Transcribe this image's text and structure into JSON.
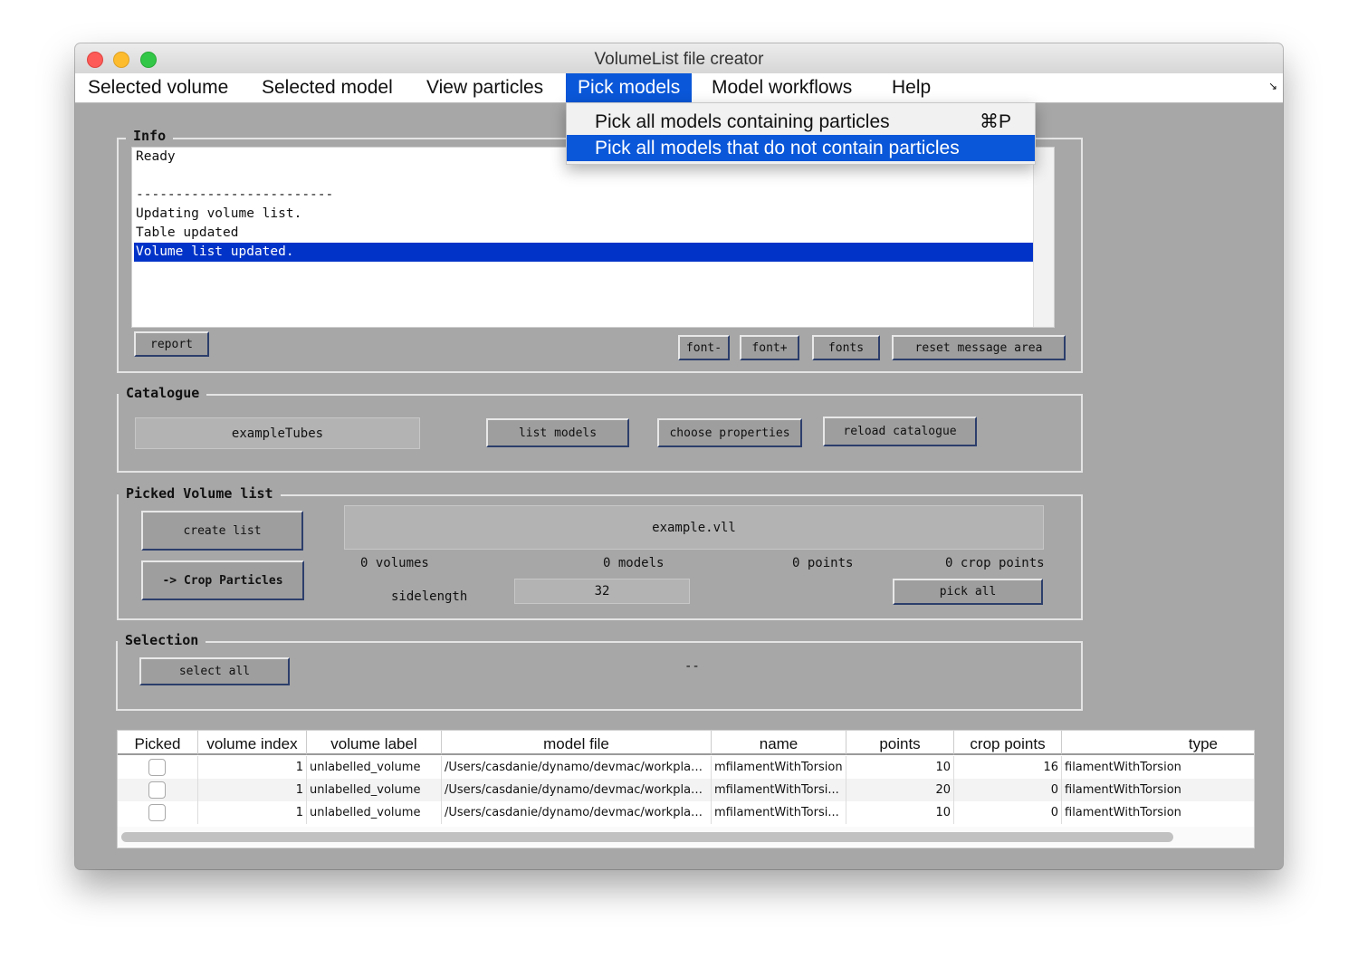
{
  "window": {
    "title": "VolumeList file creator"
  },
  "menubar": {
    "items": [
      {
        "label": "Selected volume"
      },
      {
        "label": "Selected model"
      },
      {
        "label": "View particles"
      },
      {
        "label": "Pick models"
      },
      {
        "label": "Model workflows"
      },
      {
        "label": "Help"
      }
    ],
    "active": "Pick models",
    "resize_icon": "↘"
  },
  "dropdown": {
    "items": [
      {
        "label": "Pick all models containing particles",
        "shortcut": "⌘P"
      },
      {
        "label": "Pick all models that do not contain particles",
        "shortcut": ""
      }
    ],
    "highlighted_index": 1
  },
  "info": {
    "title": "Info",
    "lines": [
      "Ready",
      "",
      "-------------------------",
      "Updating volume list.",
      "Table updated",
      "Volume list updated."
    ],
    "selected_index": 5,
    "report_label": "report",
    "font_minus_label": "font-",
    "font_plus_label": "font+",
    "fonts_label": "fonts",
    "reset_label": "reset message area"
  },
  "catalogue": {
    "title": "Catalogue",
    "name_value": "exampleTubes",
    "list_models_label": "list models",
    "choose_properties_label": "choose properties",
    "reload_label": "reload catalogue"
  },
  "picked": {
    "title": "Picked Volume list",
    "create_list_label": "create list",
    "crop_label": "-> Crop Particles",
    "file_value": "example.vll",
    "volumes_text": "0 volumes",
    "models_text": "0 models",
    "points_text": "0 points",
    "crop_points_text": "0 crop points",
    "sidelength_label": "sidelength",
    "sidelength_value": "32",
    "pick_all_label": "pick all"
  },
  "selection": {
    "title": "Selection",
    "select_all_label": "select all",
    "status": "--"
  },
  "table": {
    "columns": [
      "Picked",
      "volume index",
      "volume label",
      "model file",
      "name",
      "points",
      "crop points",
      "type"
    ],
    "rows": [
      {
        "picked": false,
        "volume_index": "1",
        "volume_label": "unlabelled_volume",
        "model_file": "/Users/casdanie/dynamo/devmac/workplac...",
        "name": "mfilamentWithTorsion",
        "points": "10",
        "crop_points": "16",
        "type": "filamentWithTorsion"
      },
      {
        "picked": false,
        "volume_index": "1",
        "volume_label": "unlabelled_volume",
        "model_file": "/Users/casdanie/dynamo/devmac/workplac...",
        "name": "mfilamentWithTorsi...",
        "points": "20",
        "crop_points": "0",
        "type": "filamentWithTorsion"
      },
      {
        "picked": false,
        "volume_index": "1",
        "volume_label": "unlabelled_volume",
        "model_file": "/Users/casdanie/dynamo/devmac/workplac...",
        "name": "mfilamentWithTorsi...",
        "points": "10",
        "crop_points": "0",
        "type": "filamentWithTorsion"
      }
    ]
  }
}
